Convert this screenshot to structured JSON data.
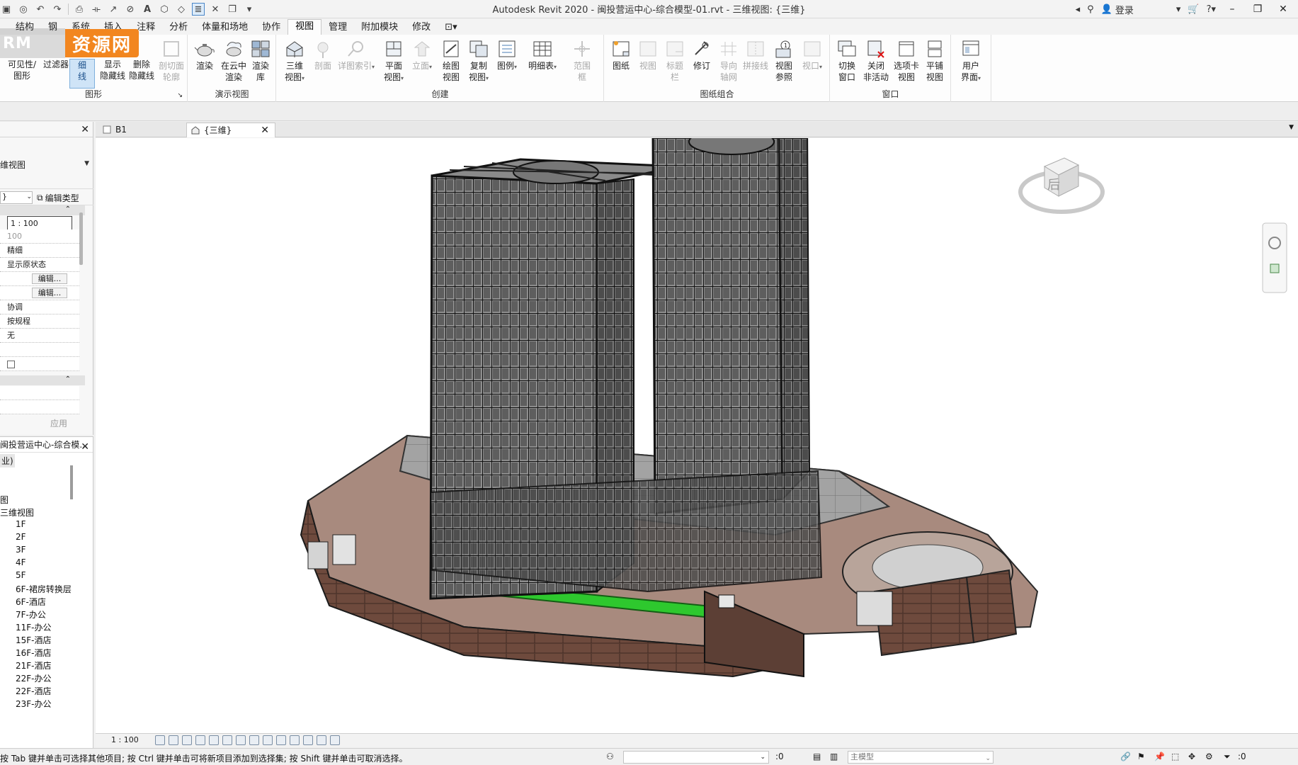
{
  "window": {
    "title": "Autodesk Revit 2020 - 闽投营运中心-综合模型-01.rvt - 三维视图: {三维}",
    "login": "登录"
  },
  "watermark": {
    "left": "RM",
    "right": "资源网"
  },
  "ribbon_tabs": [
    "结构",
    "钢",
    "系统",
    "插入",
    "注释",
    "分析",
    "体量和场地",
    "协作",
    "视图",
    "管理",
    "附加模块",
    "修改"
  ],
  "active_tab": "视图",
  "ribbon": {
    "graphics": {
      "label": "图形",
      "buttons": [
        {
          "label": "可见性/\n图形"
        },
        {
          "label": "过滤器"
        },
        {
          "label": "细\n线"
        },
        {
          "label": "显示\n隐藏线"
        },
        {
          "label": "删除\n隐藏线"
        },
        {
          "label": "剖切面\n轮廓"
        }
      ]
    },
    "presentation": {
      "label": "演示视图",
      "buttons": [
        {
          "label": "渲染"
        },
        {
          "label": "在云中\n渲染"
        },
        {
          "label": "渲染\n库"
        }
      ]
    },
    "create": {
      "label": "创建",
      "buttons": [
        {
          "label": "三维\n视图"
        },
        {
          "label": "剖面"
        },
        {
          "label": "详图索引"
        },
        {
          "label": "平面\n视图"
        },
        {
          "label": "立面"
        },
        {
          "label": "绘图\n视图"
        },
        {
          "label": "复制\n视图"
        },
        {
          "label": "图例"
        },
        {
          "label": "明细表"
        },
        {
          "label": "范围\n框"
        }
      ]
    },
    "sheet": {
      "label": "图纸组合",
      "buttons": [
        {
          "label": "图纸"
        },
        {
          "label": "视图"
        },
        {
          "label": "标题\n栏"
        },
        {
          "label": "修订"
        },
        {
          "label": "导向\n轴网"
        },
        {
          "label": "拼接线"
        },
        {
          "label": "视图\n参照"
        },
        {
          "label": "视口"
        }
      ]
    },
    "windows": {
      "label": "窗口",
      "buttons": [
        {
          "label": "切换\n窗口"
        },
        {
          "label": "关闭\n非活动"
        },
        {
          "label": "选项卡\n视图"
        },
        {
          "label": "平铺\n视图"
        }
      ]
    },
    "ui": {
      "buttons": [
        {
          "label": "用户\n界面"
        }
      ]
    }
  },
  "properties": {
    "type_name": "维视图",
    "filter_value": "}",
    "edit_type": "编辑类型",
    "rows": [
      "1 : 100",
      "100",
      "精细",
      "显示原状态",
      "编辑...",
      "编辑...",
      "协调",
      "按规程",
      "无"
    ],
    "apply": "应用"
  },
  "browser": {
    "title": "闽投营运中心-综合模...",
    "sub": "业)",
    "section": "图",
    "group": "三维视图",
    "items": [
      "1F",
      "2F",
      "3F",
      "4F",
      "5F",
      "6F-裙房转换层",
      "6F-酒店",
      "7F-办公",
      "11F-办公",
      "15F-酒店",
      "16F-酒店",
      "21F-酒店",
      "22F-办公",
      "22F-酒店",
      "23F-办公"
    ]
  },
  "view_tabs": [
    {
      "label": "B1",
      "active": false
    },
    {
      "label": "{三维}",
      "active": true
    }
  ],
  "viewcube": {
    "face": "后"
  },
  "view_control": {
    "scale": "1 : 100"
  },
  "status": {
    "message": "按 Tab 键并单击可选择其他项目; 按 Ctrl 键并单击可将新项目添加到选择集; 按 Shift 键并单击可取消选择。",
    "count_a": ":0",
    "model": "主模型",
    "count_b": ":0"
  },
  "colors": {
    "accent_tab": "#cfe4f7",
    "watermark_orange": "#f2861f",
    "podium_brown": "#6e4a3d",
    "green_strip": "#2ec82e"
  }
}
